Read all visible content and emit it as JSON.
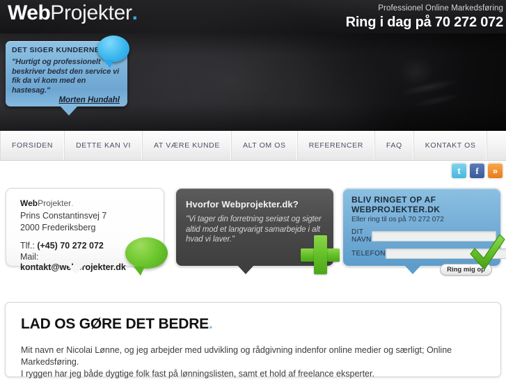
{
  "header": {
    "logo": {
      "bold": "Web",
      "light": "Projekter",
      "dot": "."
    },
    "tagline": "Professionel Online Markedsføring",
    "phone": "Ring i dag på 70 272 072"
  },
  "hero": {
    "testimonial": {
      "title": "DET SIGER KUNDERNE",
      "quote": "\"Hurtigt og professionelt beskriver bedst den service vi fik da vi kom med en hastesag.\"",
      "author": "Morten Hundahl"
    }
  },
  "nav": {
    "items": [
      {
        "label": "FORSIDEN"
      },
      {
        "label": "DETTE KAN VI"
      },
      {
        "label": "AT VÆRE KUNDE"
      },
      {
        "label": "ALT OM OS"
      },
      {
        "label": "REFERENCER"
      },
      {
        "label": "FAQ"
      },
      {
        "label": "KONTAKT OS"
      }
    ]
  },
  "social": {
    "twitter": "t",
    "facebook": "f",
    "rss": "»"
  },
  "boxes": {
    "contact": {
      "brand_bold": "Web",
      "brand_light": "Projekter",
      "brand_dot": ".",
      "address_1": "Prins Constantinsvej 7",
      "address_2": "2000 Frederiksberg",
      "tel_label": "Tlf.: ",
      "tel_value": "(+45) 70 272 072",
      "mail_label": "Mail:",
      "mail_value": "kontakt@webprojekter.dk"
    },
    "why": {
      "title": "Hvorfor Webprojekter.dk?",
      "quote": "\"Vi tager din forretning seriøst og sigter altid mod et langvarigt samarbejde i alt hvad vi laver.\""
    },
    "callback": {
      "title": "BLIV RINGET OP AF WEBPROJEKTER.DK",
      "subtitle": "Eller ring til os på 70 272 072",
      "name_label": "DIT NAVN",
      "name_value": "",
      "phone_label": "TELEFON",
      "phone_value": "",
      "button": "Ring mig op"
    }
  },
  "bottom": {
    "heading": "LAD OS GØRE DET BEDRE",
    "heading_dot": ".",
    "paragraph_1": "Mit navn er Nicolai Lønne, og jeg arbejder med udvikling og rådgivning indenfor online medier og særligt; Online Markedsføring.",
    "paragraph_2": "I ryggen har jeg både dygtige folk fast på lønningslisten, samt et hold af freelance eksperter."
  },
  "colors": {
    "accent_blue": "#3aa8e0",
    "panel_blue": "#78b0d8",
    "accent_green": "#63bf27",
    "header_dark": "#1d1d1f"
  }
}
